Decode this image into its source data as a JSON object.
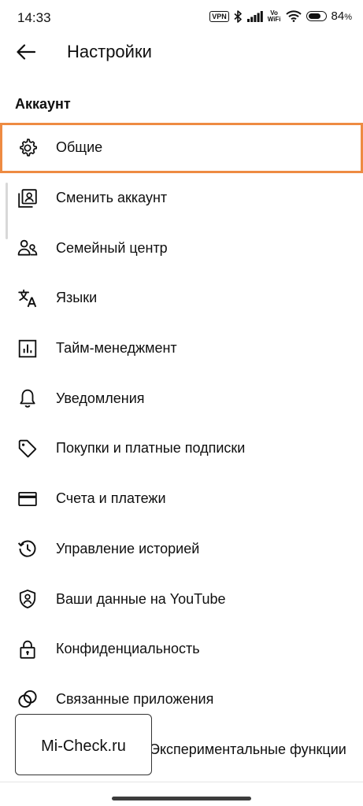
{
  "status_bar": {
    "time": "14:33",
    "vpn": "VPN",
    "vowifi_line1": "Vo",
    "vowifi_line2": "WiFi",
    "battery_value": "84",
    "battery_unit": "%",
    "battery_level": 0.84
  },
  "header": {
    "title": "Настройки",
    "back_icon": "arrow-left-icon"
  },
  "section": {
    "title": "Аккаунт"
  },
  "items": [
    {
      "label": "Общие",
      "icon": "gear-icon",
      "highlighted": true
    },
    {
      "label": "Сменить аккаунт",
      "icon": "switch-account-icon"
    },
    {
      "label": "Семейный центр",
      "icon": "family-icon"
    },
    {
      "label": "Языки",
      "icon": "translate-icon"
    },
    {
      "label": "Тайм-менеджмент",
      "icon": "bar-chart-icon"
    },
    {
      "label": "Уведомления",
      "icon": "bell-icon"
    },
    {
      "label": "Покупки и платные подписки",
      "icon": "tag-icon"
    },
    {
      "label": "Счета и платежи",
      "icon": "credit-card-icon"
    },
    {
      "label": "Управление историей",
      "icon": "history-icon"
    },
    {
      "label": "Ваши данные на YouTube",
      "icon": "shield-person-icon"
    },
    {
      "label": "Конфиденциальность",
      "icon": "lock-icon"
    },
    {
      "label": "Связанные приложения",
      "icon": "linked-circles-icon"
    },
    {
      "label": "Экспериментальные функции",
      "icon": "flask-icon"
    }
  ],
  "watermark": {
    "text": "Mi-Check.ru"
  },
  "colors": {
    "highlight": "#ee8b42",
    "text": "#0f0f0f",
    "background": "#ffffff"
  }
}
